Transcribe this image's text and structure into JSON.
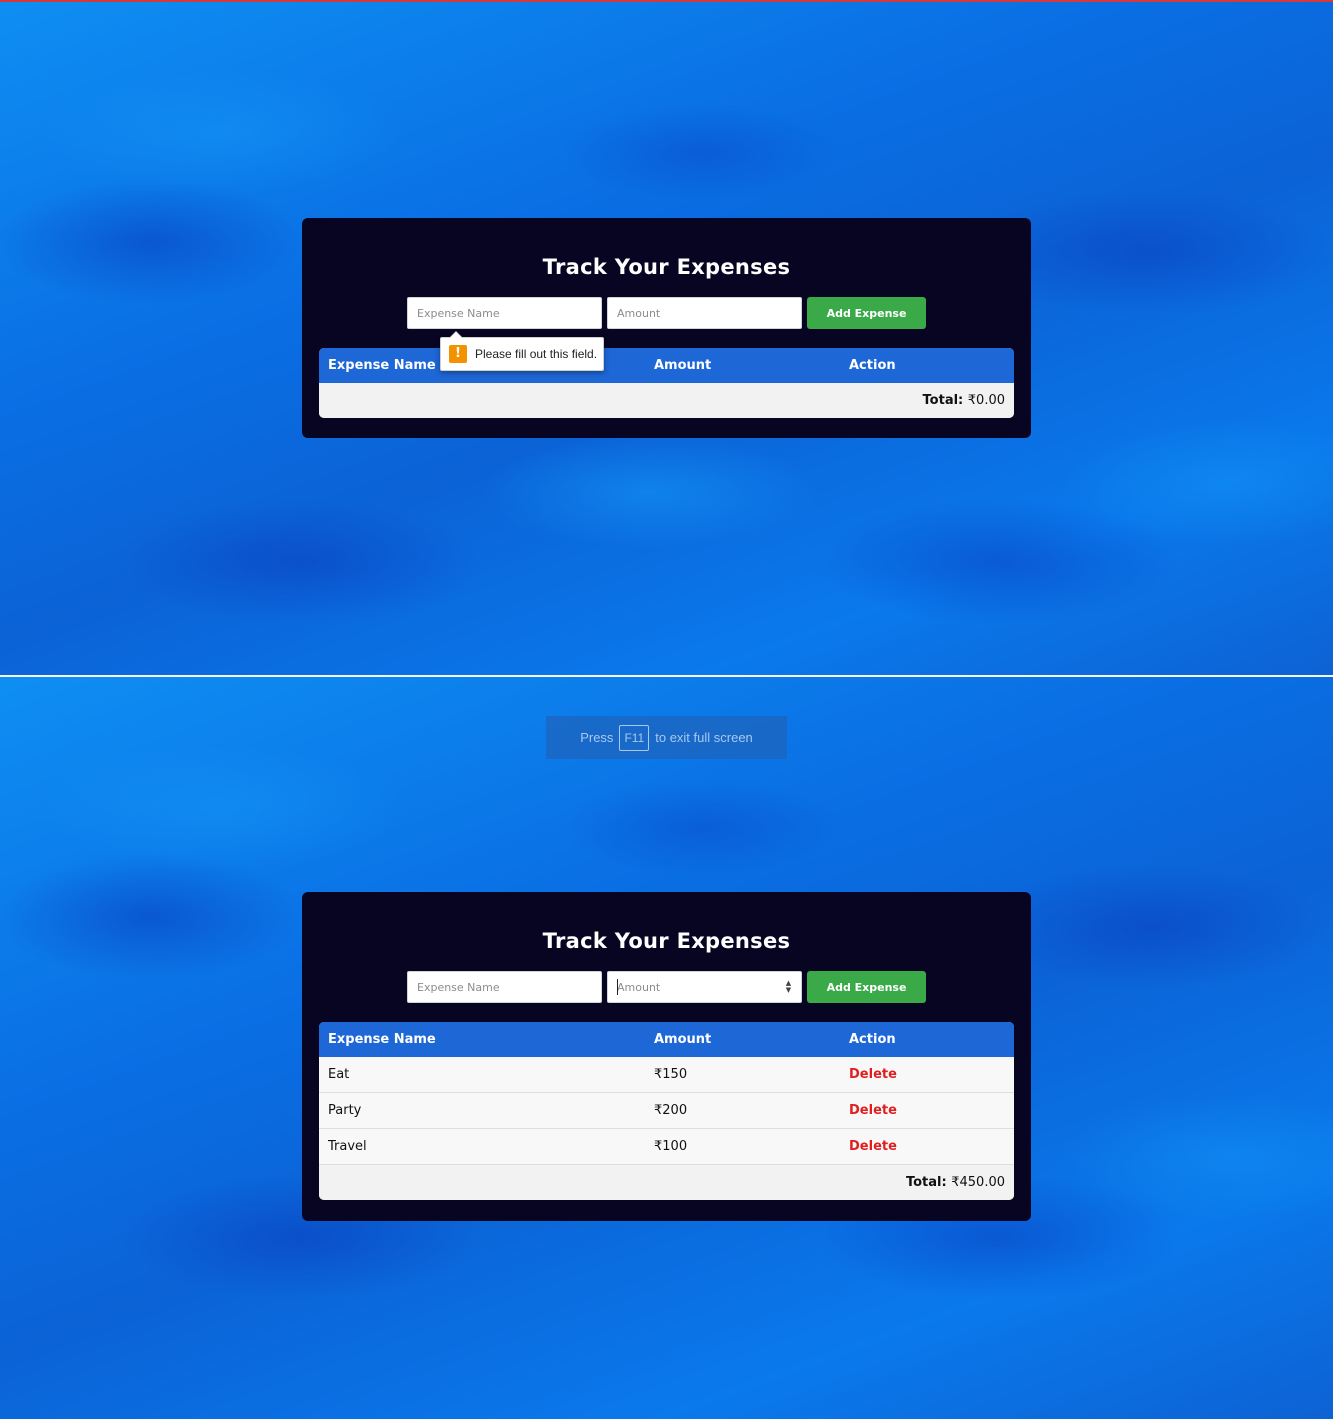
{
  "app": {
    "title": "Track Your Expenses",
    "expense_name_placeholder": "Expense Name",
    "amount_placeholder": "Amount",
    "add_button_label": "Add Expense",
    "columns": [
      "Expense Name",
      "Amount",
      "Action"
    ],
    "total_label": "Total:"
  },
  "top_state": {
    "total_value": "₹0.00",
    "validation_tooltip": "Please fill out this field.",
    "tooltip_icon": "!",
    "expenses": []
  },
  "bottom_state": {
    "fullscreen_notice": {
      "press": "Press",
      "key": "F11",
      "rest": "to exit full screen"
    },
    "expenses": [
      {
        "name": "Eat",
        "amount": "₹150",
        "action": "Delete"
      },
      {
        "name": "Party",
        "amount": "₹200",
        "action": "Delete"
      },
      {
        "name": "Travel",
        "amount": "₹100",
        "action": "Delete"
      }
    ],
    "total_value": "₹450.00"
  },
  "colors": {
    "card_bg": "#070522",
    "header_bg": "#1e67d6",
    "add_button": "#3aaa48",
    "delete_text": "#e02020",
    "warning_icon": "#f39200"
  },
  "icons": {
    "tooltip": "warning-icon",
    "amount_spinner": "number-spinner-icon"
  }
}
